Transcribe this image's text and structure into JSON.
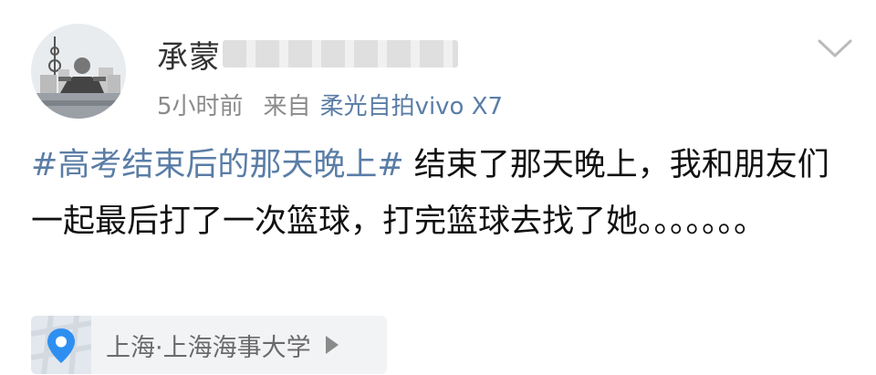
{
  "post": {
    "username": "承蒙",
    "timestamp": "5小时前",
    "from_label": "来自",
    "device": "柔光自拍vivo X7",
    "hashtag": "#高考结束后的那天晚上#",
    "body_text": " 结束了那天晚上，我和朋友们一起最后打了一次篮球，打完篮球去找了她。。。。。。。",
    "location": "上海·上海海事大学",
    "location_icon": "map-pin-icon",
    "more_icon": "chevron-down-icon",
    "colors": {
      "link": "#5a7da6",
      "text": "#111111",
      "meta": "#8a8a8a",
      "location_bg": "#f2f3f5",
      "pin": "#2f8ff0"
    }
  }
}
